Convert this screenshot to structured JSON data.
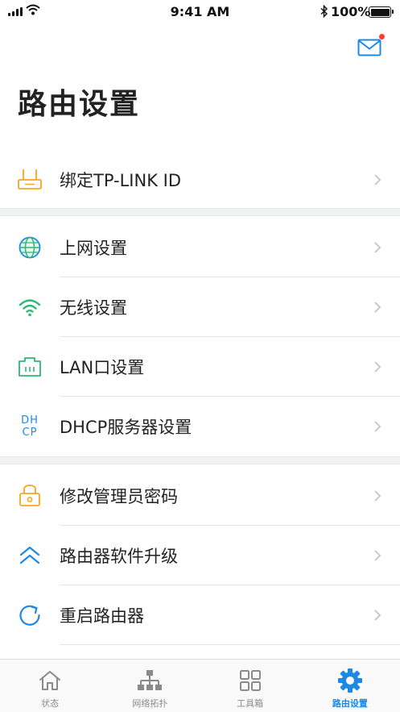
{
  "status_bar": {
    "time": "9:41 AM",
    "battery": "100%"
  },
  "page_title": "路由设置",
  "groups": [
    {
      "items": [
        {
          "label": "绑定TP-LINK ID",
          "icon": "router-icon"
        }
      ]
    },
    {
      "items": [
        {
          "label": "上网设置",
          "icon": "globe-icon"
        },
        {
          "label": "无线设置",
          "icon": "wifi-icon"
        },
        {
          "label": "LAN口设置",
          "icon": "lan-port-icon"
        },
        {
          "label": "DHCP服务器设置",
          "icon": "dhcp-icon",
          "icon_text": [
            "DH",
            "CP"
          ]
        }
      ]
    },
    {
      "items": [
        {
          "label": "修改管理员密码",
          "icon": "lock-icon"
        },
        {
          "label": "路由器软件升级",
          "icon": "upgrade-icon"
        },
        {
          "label": "重启路由器",
          "icon": "restart-icon"
        }
      ]
    }
  ],
  "tabbar": {
    "tabs": [
      {
        "label": "状态",
        "icon": "home-icon",
        "active": false
      },
      {
        "label": "网络拓扑",
        "icon": "topology-icon",
        "active": false
      },
      {
        "label": "工具箱",
        "icon": "toolbox-grid-icon",
        "active": false
      },
      {
        "label": "路由设置",
        "icon": "settings-gear-icon",
        "active": true
      }
    ]
  },
  "colors": {
    "accent_blue": "#1e88e5",
    "orange": "#f5a623",
    "green": "#2eb872",
    "badge_red": "#ff3b30",
    "inactive_gray": "#8a8a8a"
  }
}
